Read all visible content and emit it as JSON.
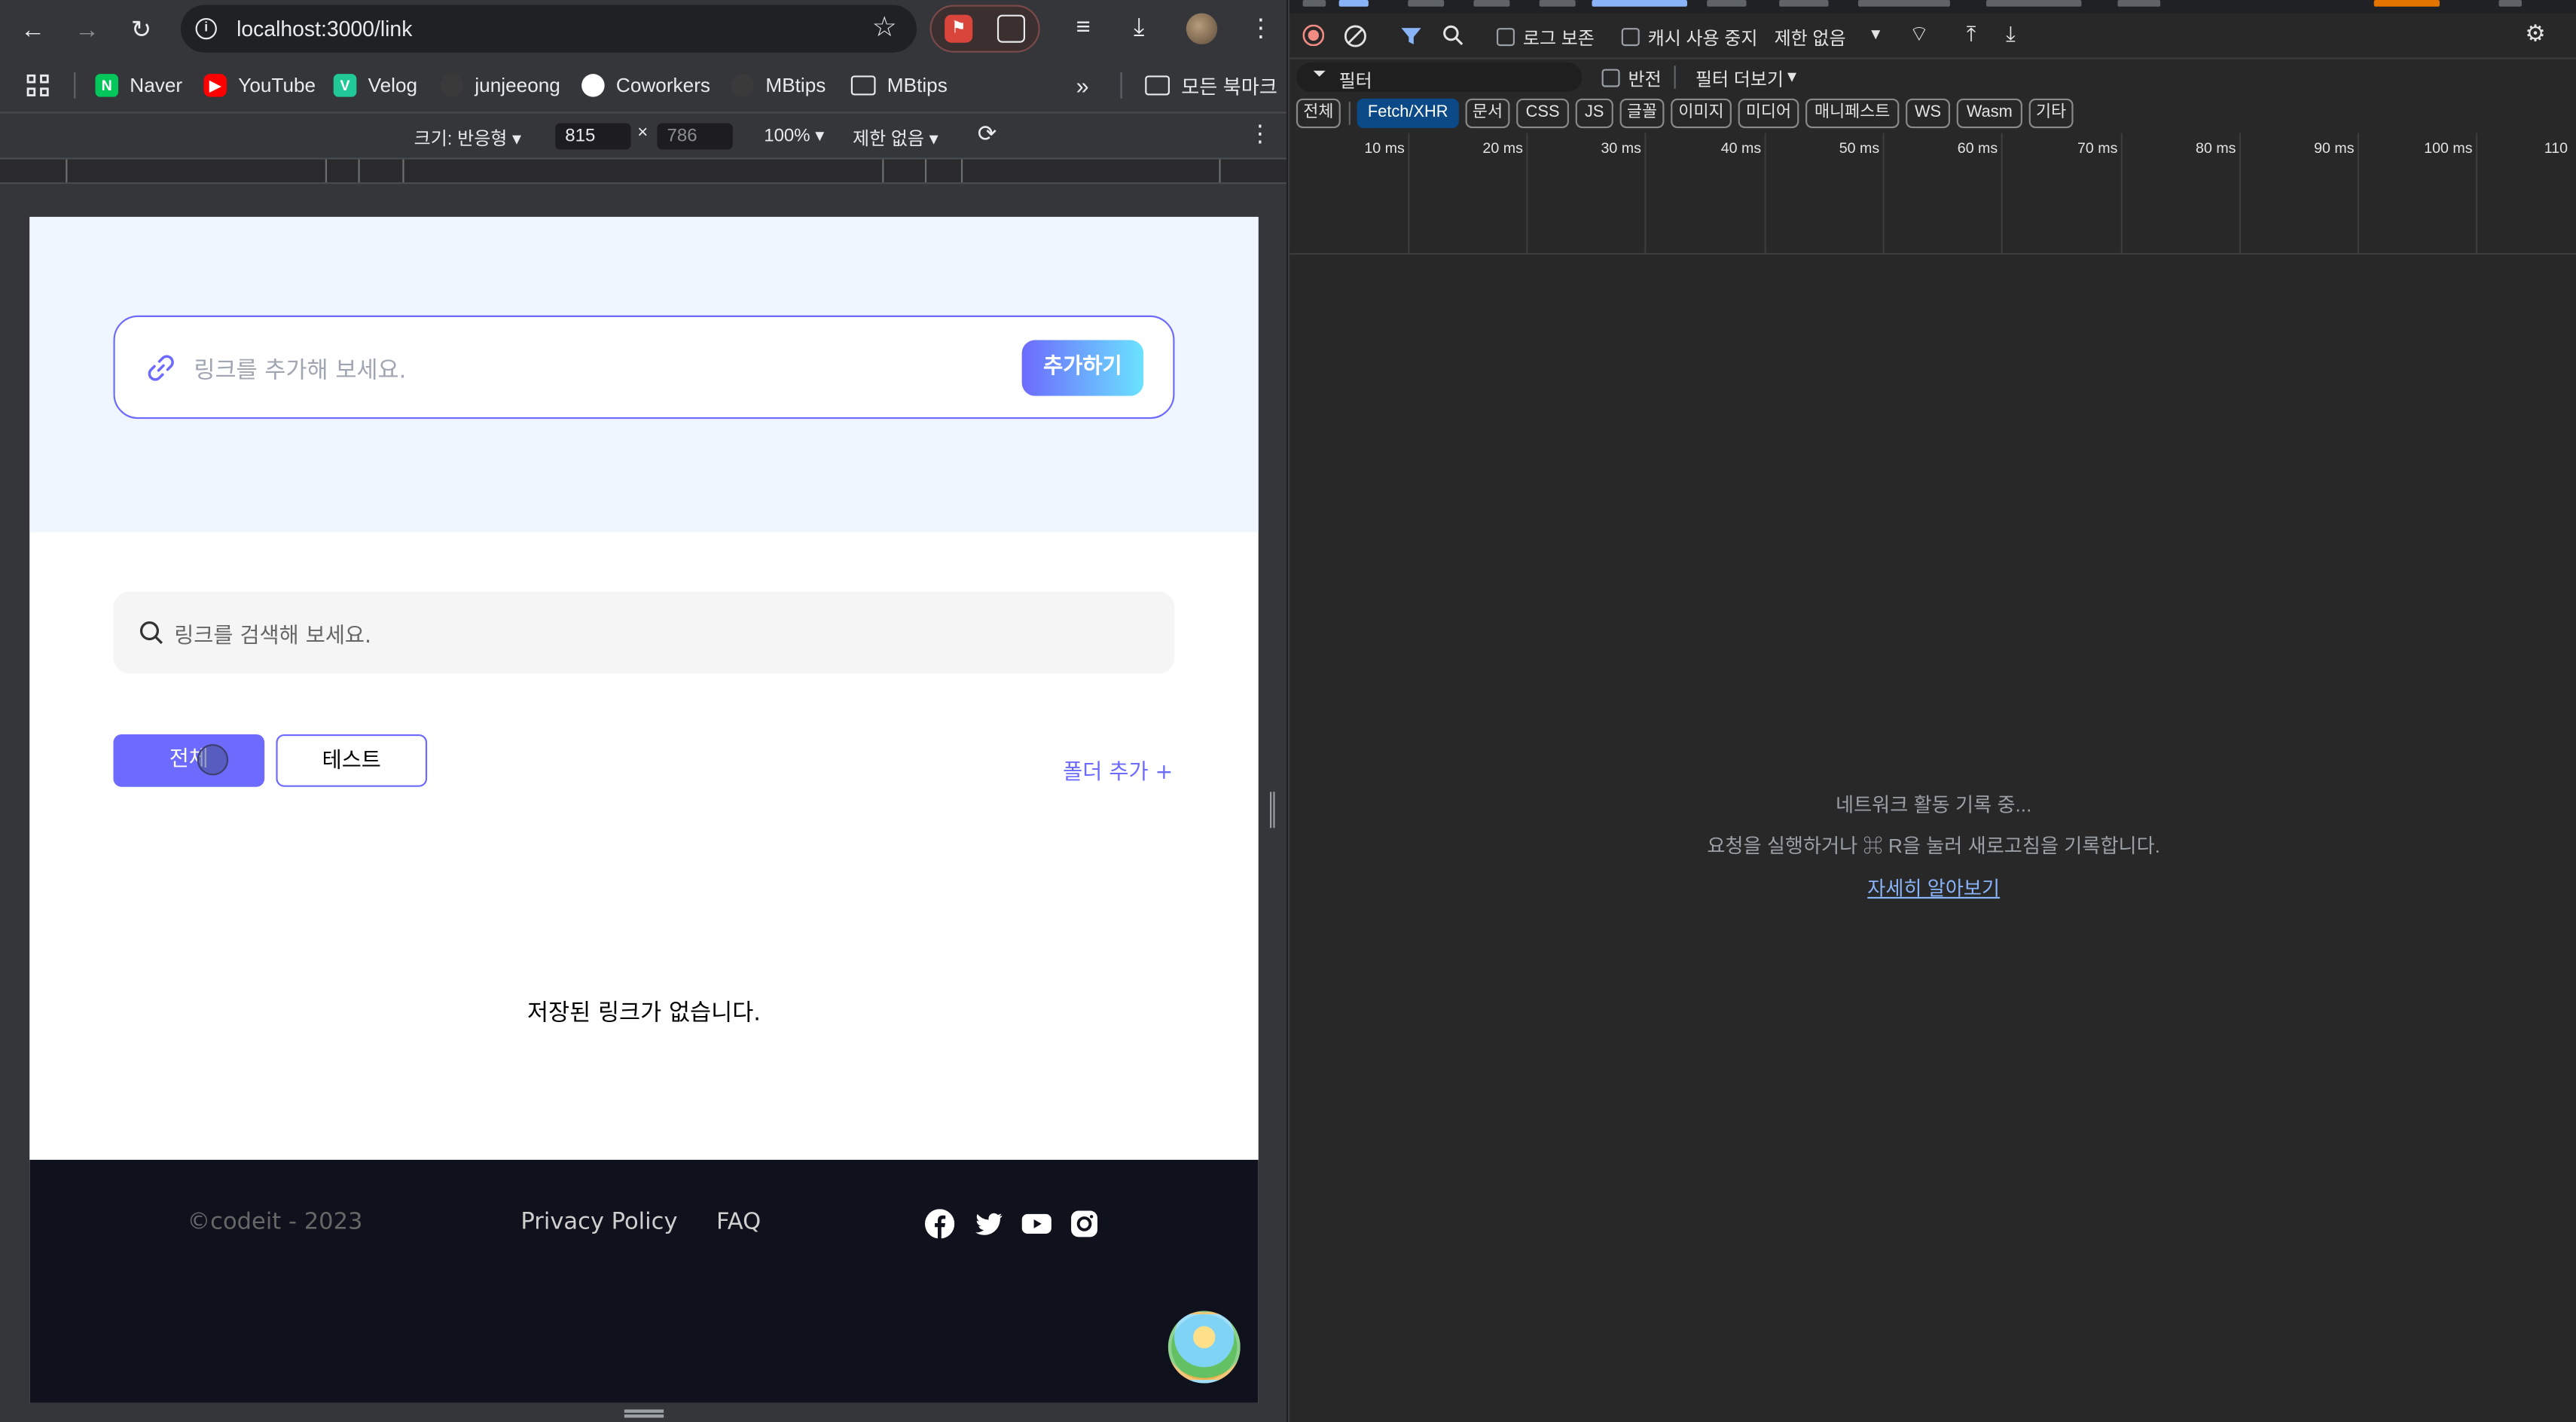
{
  "browser": {
    "url": "localhost:3000/link",
    "bookmarks": [
      {
        "label": "Naver",
        "icon": "naver-icon",
        "color": "#03c75a"
      },
      {
        "label": "YouTube",
        "icon": "youtube-icon",
        "color": "#ff0000"
      },
      {
        "label": "Velog",
        "icon": "velog-icon",
        "color": "#20c997"
      },
      {
        "label": "junjeeong",
        "icon": "github-icon",
        "color": "#3a3a3a"
      },
      {
        "label": "Coworkers",
        "icon": "github-icon",
        "color": "#ffffff"
      },
      {
        "label": "MBtips",
        "icon": "github-icon",
        "color": "#3a3a3a"
      },
      {
        "label": "MBtips",
        "icon": "folder-icon",
        "color": "#e8eaed"
      }
    ],
    "all_bookmarks": "모든 북마크",
    "overflow": "»"
  },
  "device_toolbar": {
    "size_label": "크기: 반응형",
    "width": "815",
    "x": "×",
    "height": "786",
    "zoom": "100%",
    "throttle": "제한 없음"
  },
  "page": {
    "add_placeholder": "링크를 추가해 보세요.",
    "add_button": "추가하기",
    "search_placeholder": "링크를 검색해 보세요.",
    "folders": [
      "전체",
      "테스트"
    ],
    "add_folder": "폴더 추가 +",
    "empty_message": "저장된 링크가 없습니다.",
    "footer": {
      "copyright": "©codeit - 2023",
      "privacy": "Privacy Policy",
      "faq": "FAQ",
      "social": [
        "facebook-icon",
        "twitter-icon",
        "youtube-icon",
        "instagram-icon"
      ]
    },
    "accent_color": "#6d6afe"
  },
  "devtools": {
    "toolbar": {
      "preserve_log": "로그 보존",
      "disable_cache": "캐시 사용 중지",
      "throttle": "제한 없음"
    },
    "filter": {
      "placeholder": "필터",
      "invert": "반전",
      "more_filters": "필터 더보기"
    },
    "type_filters": [
      "전체",
      "Fetch/XHR",
      "문서",
      "CSS",
      "JS",
      "글꼴",
      "이미지",
      "미디어",
      "매니페스트",
      "WS",
      "Wasm",
      "기타"
    ],
    "active_filter": "Fetch/XHR",
    "timeline_ticks": [
      "10 ms",
      "20 ms",
      "30 ms",
      "40 ms",
      "50 ms",
      "60 ms",
      "70 ms",
      "80 ms",
      "90 ms",
      "100 ms",
      "110"
    ],
    "recording_title": "네트워크 활동 기록 중...",
    "recording_hint": "요청을 실행하거나 ⌘ R을 눌러 새로고침을 기록합니다.",
    "learn_more": "자세히 알아보기"
  }
}
